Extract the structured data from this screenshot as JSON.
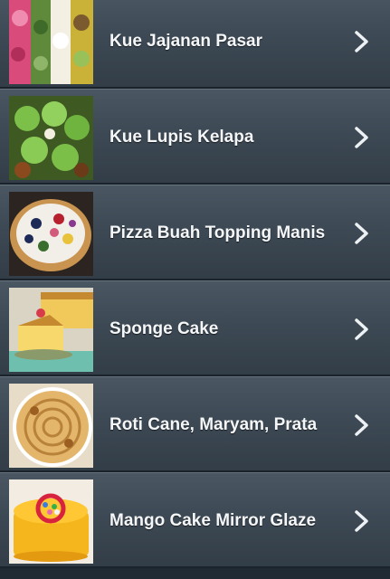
{
  "recipes": [
    {
      "title": "Kue Jajanan Pasar",
      "thumb": "kue-jajanan-pasar-photo"
    },
    {
      "title": "Kue Lupis Kelapa",
      "thumb": "kue-lupis-kelapa-photo"
    },
    {
      "title": "Pizza Buah Topping Manis",
      "thumb": "pizza-buah-photo"
    },
    {
      "title": "Sponge Cake",
      "thumb": "sponge-cake-photo"
    },
    {
      "title": "Roti Cane, Maryam, Prata",
      "thumb": "roti-cane-photo"
    },
    {
      "title": "Mango Cake Mirror Glaze",
      "thumb": "mango-cake-photo"
    }
  ],
  "icons": {
    "row_arrow": "chevron-right-icon"
  },
  "colors": {
    "row_top": "#4a5762",
    "row_bottom": "#323d47",
    "text": "#f4f6f8"
  }
}
